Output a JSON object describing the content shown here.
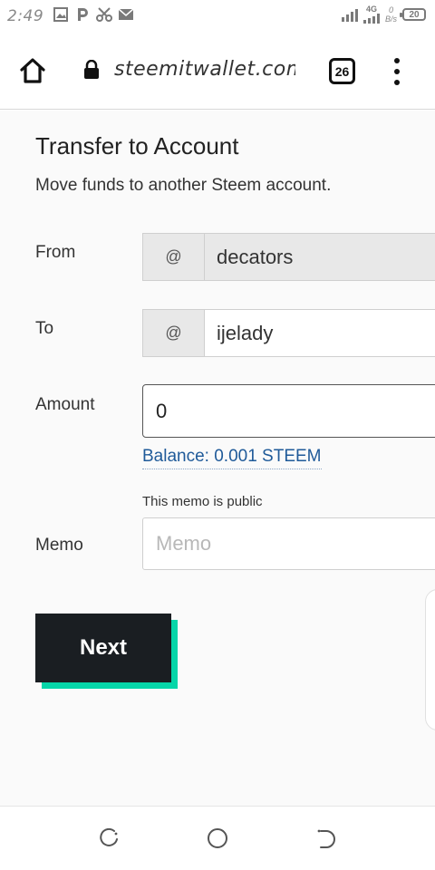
{
  "status_bar": {
    "time": "2:49",
    "network_type": "4G",
    "speed_value": "0",
    "speed_unit": "B/s",
    "battery": "20",
    "left_icons": [
      "image-icon",
      "p-icon",
      "scissors-icon",
      "mail-icon"
    ]
  },
  "browser": {
    "url": "steemitwallet.com/@",
    "tab_count": "26"
  },
  "form": {
    "title": "Transfer to Account",
    "subtitle": "Move funds to another Steem account.",
    "from": {
      "label": "From",
      "prefix": "@",
      "value": "decators"
    },
    "to": {
      "label": "To",
      "prefix": "@",
      "value": "ijelady"
    },
    "amount": {
      "label": "Amount",
      "value": "0"
    },
    "balance": "Balance: 0.001 STEEM",
    "memo": {
      "label": "Memo",
      "note": "This memo is public",
      "placeholder": "Memo"
    },
    "next_label": "Next"
  },
  "colors": {
    "next_button_bg": "#1a1e22",
    "next_button_shadow": "#06d6a9",
    "balance_link": "#1f5a99"
  }
}
